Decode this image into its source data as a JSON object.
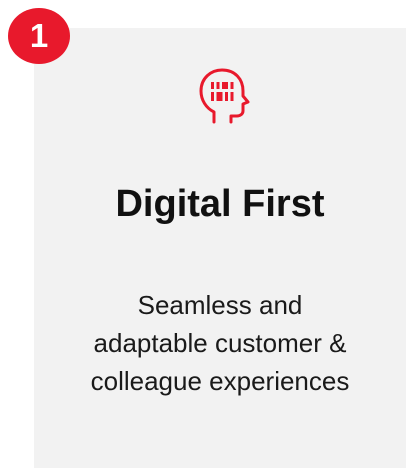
{
  "badge": {
    "number": "1"
  },
  "card": {
    "icon": "head-barcode-icon",
    "title": "Digital First",
    "description_lines": [
      "Seamless and",
      "adaptable customer &",
      "colleague experiences"
    ]
  },
  "colors": {
    "accent": "#e8192c",
    "card_background": "#f2f2f2",
    "title_text": "#111111"
  }
}
